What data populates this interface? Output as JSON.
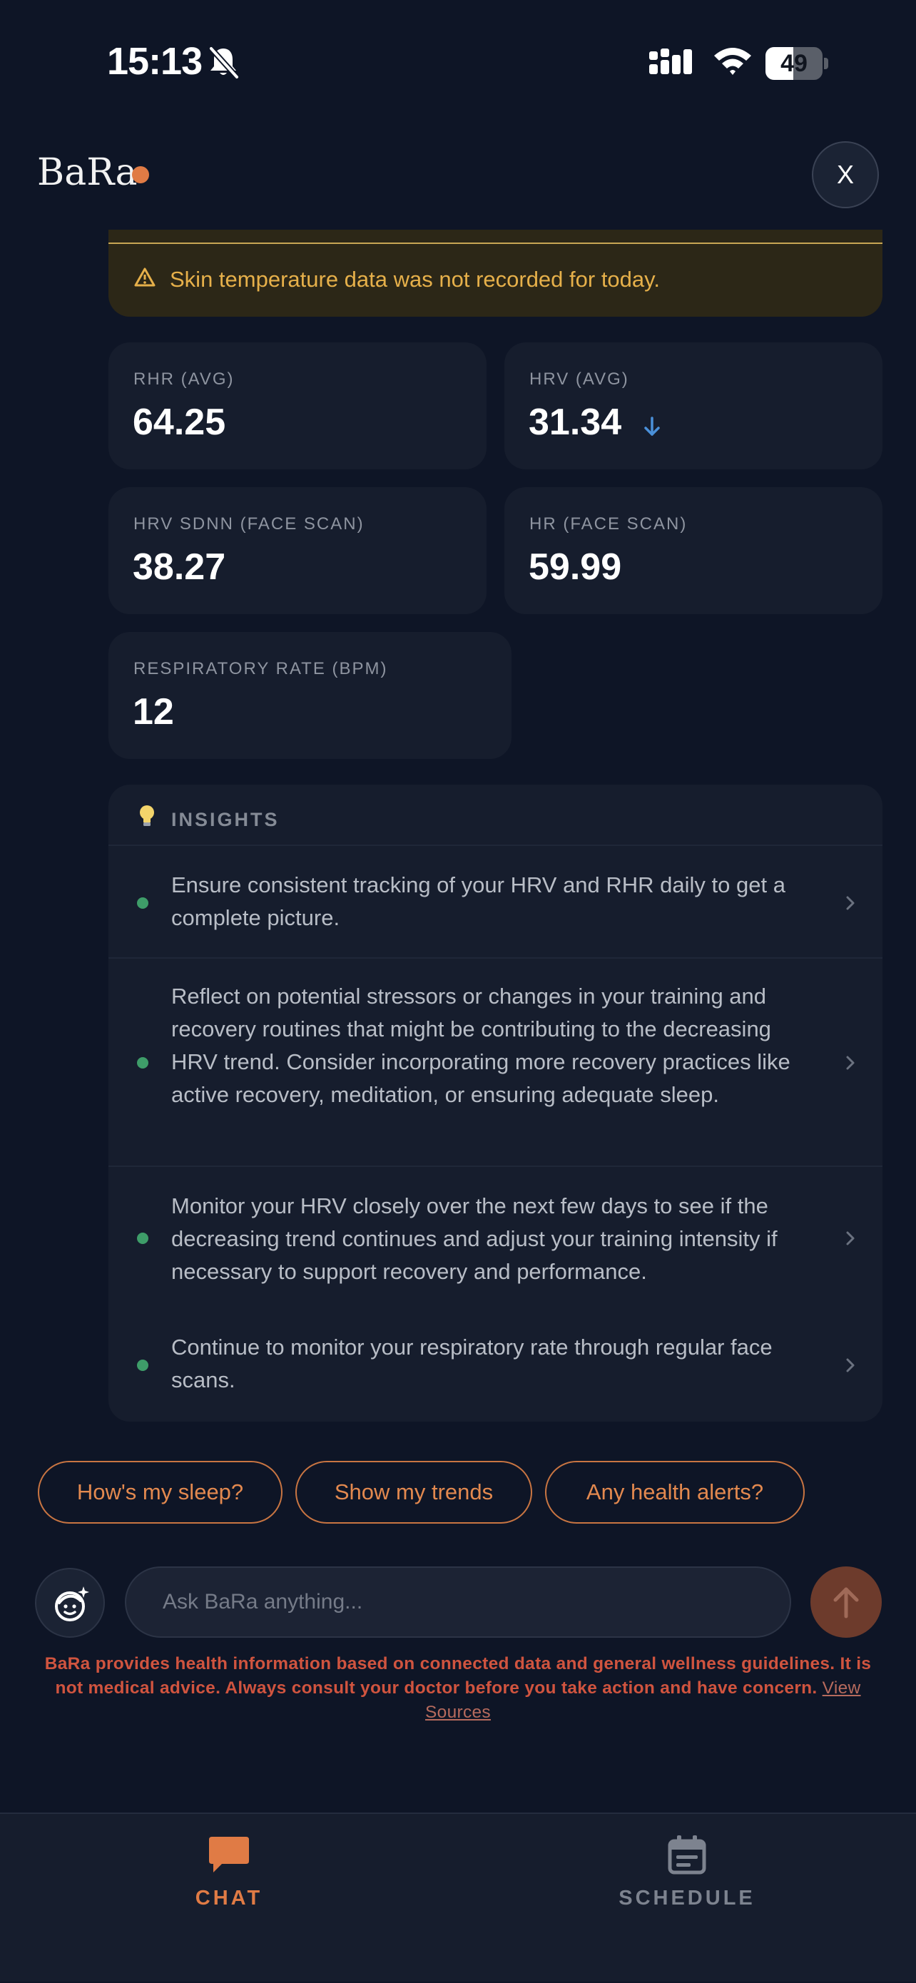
{
  "status_bar": {
    "time": "15:13",
    "battery": "49",
    "battery_level": 0.49
  },
  "header": {
    "brand": "BaRa",
    "close_label": "X"
  },
  "warning": {
    "text": "Skin temperature data was not recorded for today."
  },
  "metrics": [
    {
      "label": "RHR (AVG)",
      "value": "64.25"
    },
    {
      "label": "HRV (AVG)",
      "value": "31.34",
      "trend": "down"
    },
    {
      "label": "HRV SDNN (FACE SCAN)",
      "value": "38.27"
    },
    {
      "label": "HR (FACE SCAN)",
      "value": "59.99"
    },
    {
      "label": "RESPIRATORY RATE (BPM)",
      "value": "12"
    }
  ],
  "insights": {
    "title": "INSIGHTS",
    "items": [
      "Ensure consistent tracking of your HRV and RHR daily to get a complete picture.",
      "Reflect on potential stressors or changes in your training and recovery routines that might be contributing to the decreasing HRV trend. Consider incorporating more recovery practices like active recovery, meditation, or ensuring adequate sleep.",
      "Monitor your HRV closely over the next few days to see if the decreasing trend continues and adjust your training intensity if necessary to support recovery and performance.",
      "Continue to monitor your respiratory rate through regular face scans."
    ]
  },
  "quick_replies": [
    "How's my sleep?",
    "Show my trends",
    "Any health alerts?"
  ],
  "composer": {
    "placeholder": "Ask BaRa anything..."
  },
  "disclaimer": {
    "text": "BaRa provides health information based on connected data and general wellness guidelines. It is not medical advice. Always consult your doctor before you take action and have concern.",
    "link_label": "View Sources"
  },
  "nav": {
    "items": [
      {
        "label": "CHAT",
        "icon": "chat-bubble-icon",
        "active": true
      },
      {
        "label": "SCHEDULE",
        "icon": "calendar-icon",
        "active": false
      }
    ]
  },
  "colors": {
    "background": "#0e1526",
    "card": "#161d2d",
    "accent": "#e07b45",
    "warning": "#e6b04a",
    "insight_dot": "#3e9d69",
    "trend_down": "#4a90d9",
    "disclaimer": "#d0543f"
  }
}
